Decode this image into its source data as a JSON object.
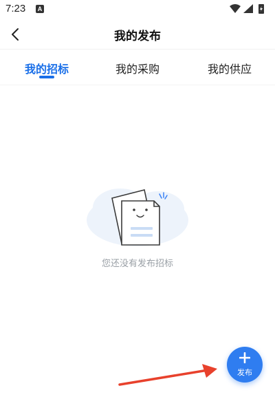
{
  "status_bar": {
    "time": "7:23",
    "notification_badge": "A"
  },
  "app_bar": {
    "title": "我的发布",
    "back_icon": "chevron-left-icon"
  },
  "tabs": [
    {
      "label": "我的招标",
      "active": true
    },
    {
      "label": "我的采购",
      "active": false
    },
    {
      "label": "我的供应",
      "active": false
    }
  ],
  "empty_state": {
    "message": "您还没有发布招标",
    "illustration": "empty-document-icon"
  },
  "fab": {
    "label": "发布",
    "icon": "plus-icon"
  },
  "colors": {
    "accent": "#1a6fe8",
    "fab": "#2f7df0",
    "annotation_arrow": "#e8412c"
  }
}
